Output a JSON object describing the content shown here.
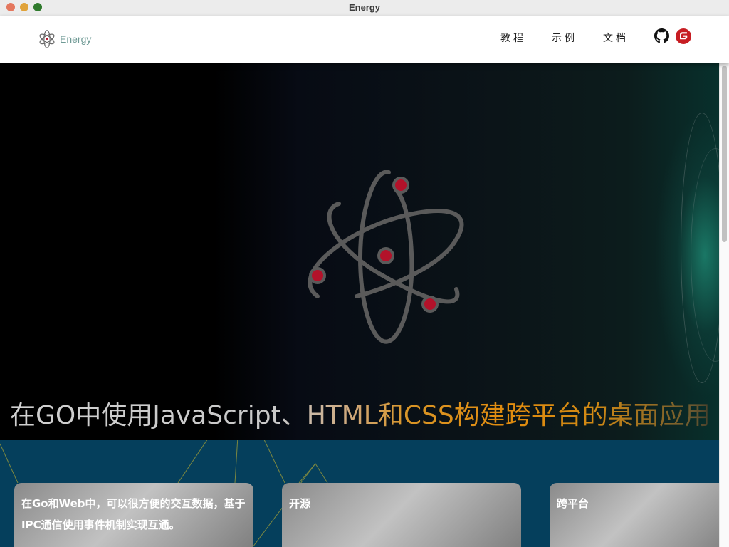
{
  "window": {
    "title": "Energy"
  },
  "nav": {
    "brand": "Energy",
    "links": [
      "教程",
      "示例",
      "文档"
    ],
    "icons": [
      "github-icon",
      "gitee-icon"
    ]
  },
  "hero": {
    "title": "在GO中使用JavaScript、HTML和CSS构建跨平台的桌面应用"
  },
  "features": [
    {
      "text": "在Go和Web中，可以很方便的交互数据，基于IPC通信使用事件机制实现互通。"
    },
    {
      "text": "开源"
    },
    {
      "text": "跨平台"
    }
  ],
  "colors": {
    "brand_text": "#6f9a95",
    "atom_ring": "#5a5a5a",
    "electron": "#b3122a",
    "bottom_bg": "#053f5c",
    "title_accent": "#e18c0f"
  }
}
